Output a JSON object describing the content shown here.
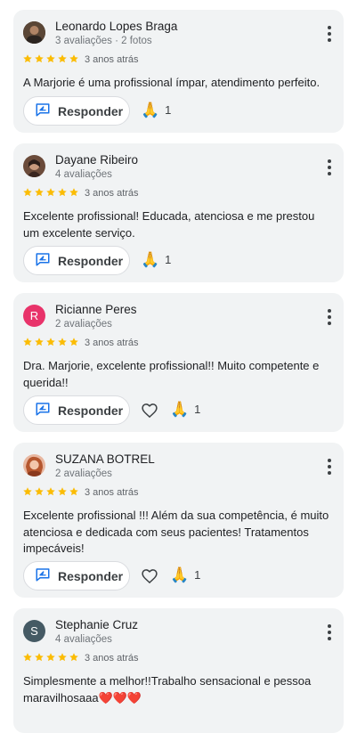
{
  "colors": {
    "star": "#fbbc04",
    "reply_icon": "#1a73e8",
    "card_bg": "#f1f3f4",
    "avatar_r": "#e8336a",
    "avatar_s": "#455a64"
  },
  "reply_label": "Responder",
  "reviews": [
    {
      "name": "Leonardo Lopes Braga",
      "meta": "3 avaliações · 2 fotos",
      "time": "3 anos atrás",
      "text": "A Marjorie é uma profissional ímpar, atendimento perfeito.",
      "reaction_count": "1"
    },
    {
      "name": "Dayane Ribeiro",
      "meta": "4 avaliações",
      "time": "3 anos atrás",
      "text": "Excelente profissional! Educada, atenciosa e me prestou um excelente serviço.",
      "reaction_count": "1"
    },
    {
      "name": "Ricianne Peres",
      "avatar_letter": "R",
      "meta": "2 avaliações",
      "time": "3 anos atrás",
      "text": "Dra. Marjorie, excelente profissional!! Muito competente e querida!!",
      "reaction_count": "1"
    },
    {
      "name": "SUZANA BOTREL",
      "meta": "2 avaliações",
      "time": "3 anos atrás",
      "text": "Excelente profissional !!! Além da sua competência, é muito atenciosa e dedicada com seus pacientes! Tratamentos impecáveis!",
      "reaction_count": "1"
    },
    {
      "name": "Stephanie Cruz",
      "avatar_letter": "S",
      "meta": "4 avaliações",
      "time": "3 anos atrás",
      "text": "Simplesmente a melhor!!Trabalho sensacional e pessoa maravilhosaaa❤️❤️❤️",
      "reaction_count": ""
    }
  ]
}
